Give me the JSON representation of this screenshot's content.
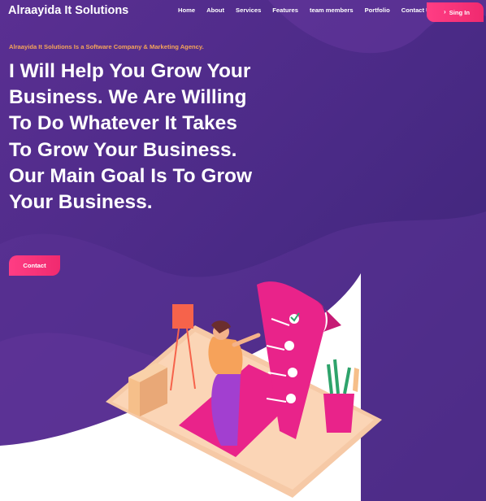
{
  "header": {
    "brand": "Alraayida It Solutions",
    "nav": [
      "Home",
      "About",
      "Services",
      "Features",
      "team members",
      "Portfolio",
      "Contact Us"
    ],
    "signin_label": "Sing In"
  },
  "hero": {
    "tagline": "Alraayida It Solutions Is a Software Company & Marketing Agency.",
    "headline": "I Will Help You Grow Your Business. We Are Willing To Do Whatever It Takes To Grow Your Business. Our Main Goal Is To Grow Your Business.",
    "contact_label": "Contact"
  },
  "icons": {
    "signin": "chevron-right-icon"
  },
  "colors": {
    "background": "#4b2a86",
    "accent": "#f02a6f",
    "tagline": "#f5a55a",
    "text": "#ffffff"
  }
}
